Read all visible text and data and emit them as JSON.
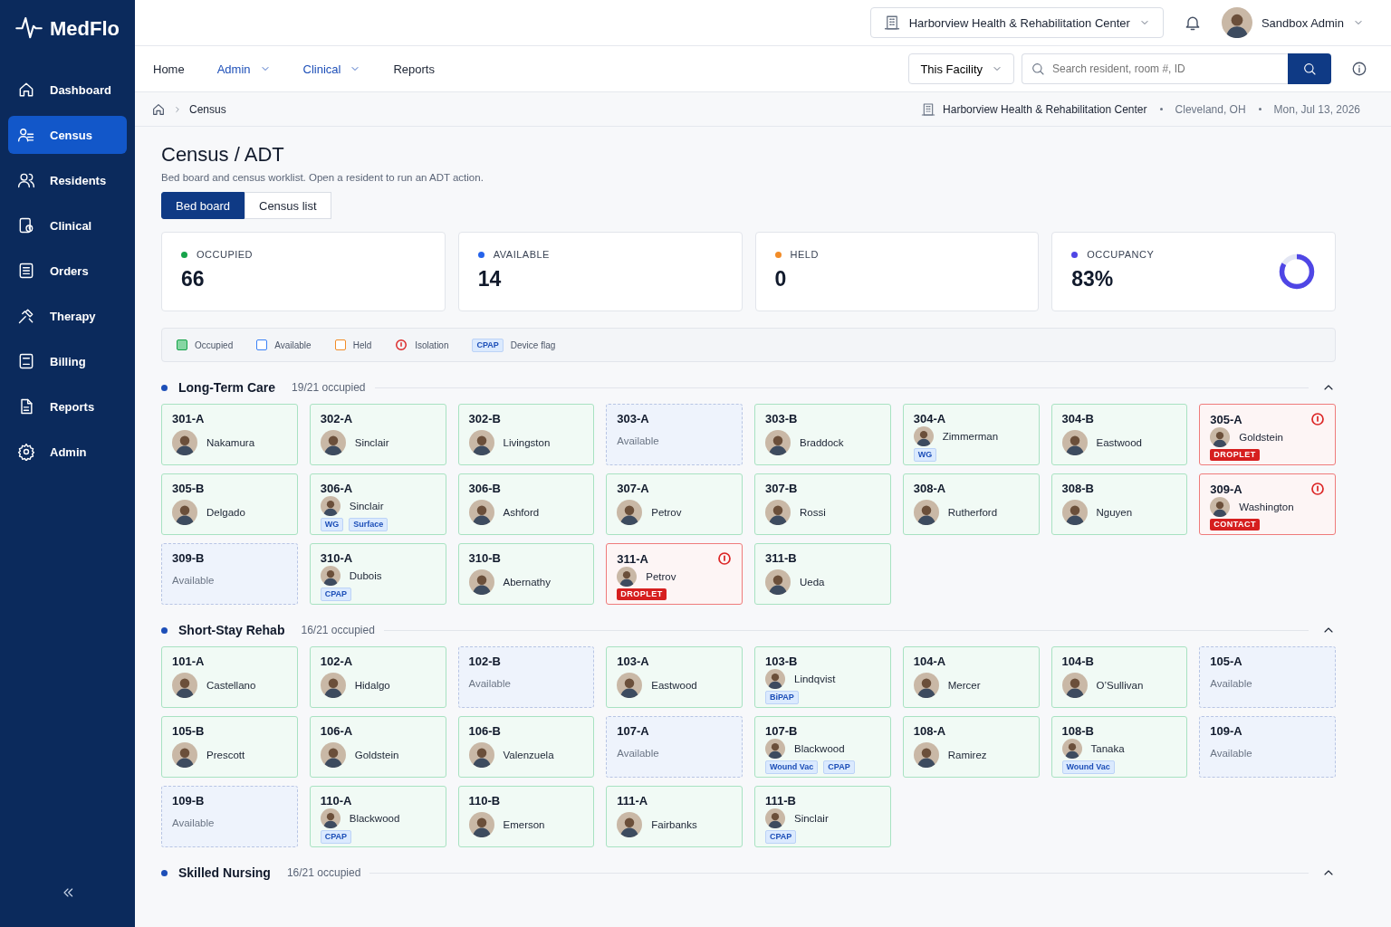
{
  "app": {
    "name": "MedFlo"
  },
  "sidebar": {
    "items": [
      {
        "label": "Dashboard",
        "selected": false
      },
      {
        "label": "Census",
        "selected": true
      },
      {
        "label": "Residents",
        "selected": false
      },
      {
        "label": "Clinical",
        "selected": false
      },
      {
        "label": "Orders",
        "selected": false
      },
      {
        "label": "Therapy",
        "selected": false
      },
      {
        "label": "Billing",
        "selected": false
      },
      {
        "label": "Reports",
        "selected": false
      },
      {
        "label": "Admin",
        "selected": false
      }
    ]
  },
  "header": {
    "facility": "Harborview Health & Rehabilitation Center",
    "user": "Sandbox Admin"
  },
  "nav": {
    "links": [
      {
        "label": "Home",
        "dropdown": false
      },
      {
        "label": "Admin",
        "dropdown": true
      },
      {
        "label": "Clinical",
        "dropdown": true
      },
      {
        "label": "Reports",
        "dropdown": false
      }
    ],
    "scope": "This Facility",
    "search": {
      "placeholder": "Search resident, room #, ID"
    }
  },
  "breadcrumb": {
    "items": [
      "Census"
    ],
    "facility": "Harborview Health & Rehabilitation Center",
    "location": "Cleveland, OH",
    "date": "Mon, Jul 13, 2026"
  },
  "page": {
    "title": "Census / ADT",
    "subtitle": "Bed board and census worklist. Open a resident to run an ADT action."
  },
  "views": [
    {
      "label": "Bed board",
      "selected": true
    },
    {
      "label": "Census list",
      "selected": false
    }
  ],
  "stats": [
    {
      "label": "OCCUPIED",
      "value": "66",
      "color": "#16a34a"
    },
    {
      "label": "AVAILABLE",
      "value": "14",
      "color": "#2563eb"
    },
    {
      "label": "HELD",
      "value": "0",
      "color": "#f28c28"
    },
    {
      "label": "OCCUPANCY",
      "value": "83%",
      "color": "#4f46e5",
      "level": 0.83
    }
  ],
  "legend": [
    {
      "kind": "occupied",
      "label": "Occupied"
    },
    {
      "kind": "available",
      "label": "Available"
    },
    {
      "kind": "held",
      "label": "Held"
    },
    {
      "kind": "isolation",
      "label": "Isolation"
    },
    {
      "kind": "device",
      "badge": "CPAP",
      "label": "Device flag"
    }
  ],
  "units": [
    {
      "name": "Long-Term Care",
      "count": "19/21 occupied",
      "expanded": true,
      "beds": [
        {
          "room": "301-A",
          "kind": "occupied",
          "resident": "Nakamura",
          "isolation": false
        },
        {
          "room": "302-A",
          "kind": "occupied",
          "resident": "Sinclair",
          "isolation": false
        },
        {
          "room": "302-B",
          "kind": "occupied",
          "resident": "Livingston",
          "isolation": false
        },
        {
          "room": "303-A",
          "kind": "available",
          "resident": "Available",
          "isolation": false
        },
        {
          "room": "303-B",
          "kind": "occupied",
          "resident": "Braddock",
          "isolation": false
        },
        {
          "room": "304-A",
          "kind": "occupied",
          "resident": "Zimmerman",
          "isolation": false,
          "tags": [
            {
              "label": "WG",
              "kind": "device"
            }
          ]
        },
        {
          "room": "304-B",
          "kind": "occupied",
          "resident": "Eastwood",
          "isolation": false
        },
        {
          "room": "305-A",
          "kind": "occupied",
          "resident": "Goldstein",
          "isolation": true,
          "tags": [
            {
              "label": "DROPLET",
              "kind": "precaution"
            }
          ]
        },
        {
          "room": "305-B",
          "kind": "occupied",
          "resident": "Delgado",
          "isolation": false
        },
        {
          "room": "306-A",
          "kind": "occupied",
          "resident": "Sinclair",
          "isolation": false,
          "tags": [
            {
              "label": "WG",
              "kind": "device"
            },
            {
              "label": "Surface",
              "kind": "device"
            }
          ]
        },
        {
          "room": "306-B",
          "kind": "occupied",
          "resident": "Ashford",
          "isolation": false
        },
        {
          "room": "307-A",
          "kind": "occupied",
          "resident": "Petrov",
          "isolation": false
        },
        {
          "room": "307-B",
          "kind": "occupied",
          "resident": "Rossi",
          "isolation": false
        },
        {
          "room": "308-A",
          "kind": "occupied",
          "resident": "Rutherford",
          "isolation": false
        },
        {
          "room": "308-B",
          "kind": "occupied",
          "resident": "Nguyen",
          "isolation": false
        },
        {
          "room": "309-A",
          "kind": "occupied",
          "resident": "Washington",
          "isolation": true,
          "tags": [
            {
              "label": "CONTACT",
              "kind": "precaution"
            }
          ]
        },
        {
          "room": "309-B",
          "kind": "available",
          "resident": "Available",
          "isolation": false
        },
        {
          "room": "310-A",
          "kind": "occupied",
          "resident": "Dubois",
          "isolation": false,
          "tags": [
            {
              "label": "CPAP",
              "kind": "device"
            }
          ]
        },
        {
          "room": "310-B",
          "kind": "occupied",
          "resident": "Abernathy",
          "isolation": false
        },
        {
          "room": "311-A",
          "kind": "occupied",
          "resident": "Petrov",
          "isolation": true,
          "tags": [
            {
              "label": "DROPLET",
              "kind": "precaution"
            }
          ]
        },
        {
          "room": "311-B",
          "kind": "occupied",
          "resident": "Ueda",
          "isolation": false
        }
      ]
    },
    {
      "name": "Short-Stay Rehab",
      "count": "16/21 occupied",
      "expanded": true,
      "beds": [
        {
          "room": "101-A",
          "kind": "occupied",
          "resident": "Castellano",
          "isolation": false
        },
        {
          "room": "102-A",
          "kind": "occupied",
          "resident": "Hidalgo",
          "isolation": false
        },
        {
          "room": "102-B",
          "kind": "available",
          "resident": "Available",
          "isolation": false
        },
        {
          "room": "103-A",
          "kind": "occupied",
          "resident": "Eastwood",
          "isolation": false
        },
        {
          "room": "103-B",
          "kind": "occupied",
          "resident": "Lindqvist",
          "isolation": false,
          "tags": [
            {
              "label": "BiPAP",
              "kind": "device"
            }
          ]
        },
        {
          "room": "104-A",
          "kind": "occupied",
          "resident": "Mercer",
          "isolation": false
        },
        {
          "room": "104-B",
          "kind": "occupied",
          "resident": "O’Sullivan",
          "isolation": false
        },
        {
          "room": "105-A",
          "kind": "available",
          "resident": "Available",
          "isolation": false
        },
        {
          "room": "105-B",
          "kind": "occupied",
          "resident": "Prescott",
          "isolation": false
        },
        {
          "room": "106-A",
          "kind": "occupied",
          "resident": "Goldstein",
          "isolation": false
        },
        {
          "room": "106-B",
          "kind": "occupied",
          "resident": "Valenzuela",
          "isolation": false
        },
        {
          "room": "107-A",
          "kind": "available",
          "resident": "Available",
          "isolation": false
        },
        {
          "room": "107-B",
          "kind": "occupied",
          "resident": "Blackwood",
          "isolation": false,
          "tags": [
            {
              "label": "Wound Vac",
              "kind": "device"
            },
            {
              "label": "CPAP",
              "kind": "device"
            }
          ]
        },
        {
          "room": "108-A",
          "kind": "occupied",
          "resident": "Ramirez",
          "isolation": false
        },
        {
          "room": "108-B",
          "kind": "occupied",
          "resident": "Tanaka",
          "isolation": false,
          "tags": [
            {
              "label": "Wound Vac",
              "kind": "device"
            }
          ]
        },
        {
          "room": "109-A",
          "kind": "available",
          "resident": "Available",
          "isolation": false
        },
        {
          "room": "109-B",
          "kind": "available",
          "resident": "Available",
          "isolation": false
        },
        {
          "room": "110-A",
          "kind": "occupied",
          "resident": "Blackwood",
          "isolation": false,
          "tags": [
            {
              "label": "CPAP",
              "kind": "device"
            }
          ]
        },
        {
          "room": "110-B",
          "kind": "occupied",
          "resident": "Emerson",
          "isolation": false
        },
        {
          "room": "111-A",
          "kind": "occupied",
          "resident": "Fairbanks",
          "isolation": false
        },
        {
          "room": "111-B",
          "kind": "occupied",
          "resident": "Sinclair",
          "isolation": false,
          "tags": [
            {
              "label": "CPAP",
              "kind": "device"
            }
          ]
        }
      ]
    },
    {
      "name": "Skilled Nursing",
      "count": "16/21 occupied",
      "expanded": true
    }
  ]
}
